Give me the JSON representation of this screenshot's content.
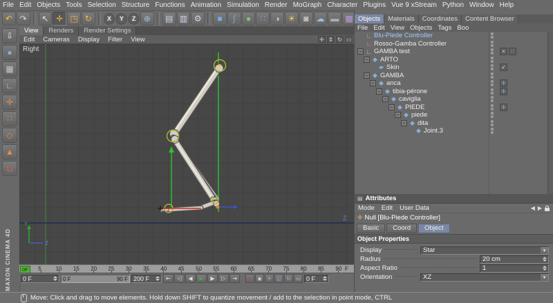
{
  "window": {
    "status_bar": {
      "icon": "mouse-icon",
      "text": "Move: Click and drag to move elements. Hold down SHIFT to quantize movement / add to the selection in point mode, CTRL"
    }
  },
  "menubar": {
    "items": [
      "File",
      "Edit",
      "Objects",
      "Tools",
      "Selection",
      "Structure",
      "Functions",
      "Animation",
      "Simulation",
      "Render",
      "MoGraph",
      "Character",
      "Plugins",
      "Vue 9 xStream",
      "Python",
      "Window",
      "Help"
    ]
  },
  "toolbar": {
    "icons": [
      {
        "name": "undo-icon",
        "glyph": "↶",
        "color": "#f0c040"
      },
      {
        "name": "redo-icon",
        "glyph": "↷",
        "color": "#d8d8d8"
      },
      {
        "sep": true
      },
      {
        "name": "live-selection-icon",
        "glyph": "↖",
        "color": "#e8e8e8"
      },
      {
        "name": "move-tool-icon",
        "glyph": "✛",
        "color": "#f0b840",
        "active": true
      },
      {
        "name": "scale-tool-icon",
        "glyph": "◳",
        "color": "#f0b840"
      },
      {
        "name": "rotate-tool-icon",
        "glyph": "↻",
        "color": "#f0b840"
      },
      {
        "sep": true
      },
      {
        "name": "x-axis-lock-button",
        "glyph": "X",
        "circle": true
      },
      {
        "name": "y-axis-lock-button",
        "glyph": "Y",
        "circle": true
      },
      {
        "name": "z-axis-lock-button",
        "glyph": "Z",
        "circle": true
      },
      {
        "name": "coordinate-system-icon",
        "glyph": "⊕",
        "color": "#9ac0e8"
      },
      {
        "sep": true
      },
      {
        "name": "render-view-icon",
        "glyph": "▤",
        "color": "#cfd8e8"
      },
      {
        "name": "render-picture-viewer-icon",
        "glyph": "▥",
        "color": "#cfd8e8"
      },
      {
        "name": "render-settings-icon",
        "glyph": "⚙",
        "color": "#cfd8e8"
      },
      {
        "sep": true
      },
      {
        "name": "add-cube-icon",
        "glyph": "■",
        "color": "#78a8e0"
      },
      {
        "name": "add-spline-icon",
        "glyph": "∫",
        "color": "#78a8e0"
      },
      {
        "name": "add-hypernurbs-icon",
        "glyph": "●",
        "color": "#7ec86a"
      },
      {
        "name": "add-array-icon",
        "glyph": "∷",
        "color": "#78a8e0"
      },
      {
        "name": "add-boole-icon",
        "glyph": "◑",
        "color": "#c8c8c8"
      },
      {
        "name": "add-light-icon",
        "glyph": "☀",
        "color": "#f0d048"
      },
      {
        "name": "add-camera-icon",
        "glyph": "◙",
        "color": "#c8c8c8"
      },
      {
        "name": "add-sky-icon",
        "glyph": "☁",
        "color": "#9ac0e8"
      },
      {
        "name": "add-floor-icon",
        "glyph": "▬",
        "color": "#b0b0b0"
      },
      {
        "name": "add-background-icon",
        "glyph": "▩",
        "color": "#b89ad8"
      }
    ]
  },
  "left_palette": {
    "brand": "MAXON CINEMA 4D",
    "icons": [
      {
        "name": "make-editable-icon",
        "glyph": "⇩",
        "color": "#e8e8e8"
      },
      {
        "name": "model-mode-icon",
        "glyph": "●",
        "color": "#88b0d8"
      },
      {
        "name": "texture-mode-icon",
        "glyph": "▦",
        "color": "#c8c8c8"
      },
      {
        "name": "workplane-mode-icon",
        "glyph": "∟",
        "color": "#c8c8c8"
      },
      {
        "name": "object-axis-mode-icon",
        "glyph": "✛",
        "color": "#e89040"
      },
      {
        "name": "points-mode-icon",
        "glyph": "∷",
        "color": "#e89040"
      },
      {
        "name": "edges-mode-icon",
        "glyph": "◇",
        "color": "#e89040"
      },
      {
        "name": "polygons-mode-icon",
        "glyph": "▲",
        "color": "#e89040"
      },
      {
        "name": "snap-settings-icon",
        "glyph": "⊔",
        "color": "#e06040"
      }
    ]
  },
  "viewport": {
    "view_label": "Right",
    "tabs": [
      {
        "label": "View",
        "active": true
      },
      {
        "label": "Renders",
        "active": false
      },
      {
        "label": "Render Settings",
        "active": false
      }
    ],
    "menu": [
      "Edit",
      "Cameras",
      "Display",
      "Filter",
      "View"
    ],
    "corner_icons": [
      {
        "name": "pan-view-icon",
        "glyph": "✛"
      },
      {
        "name": "dolly-view-icon",
        "glyph": "⇕"
      },
      {
        "name": "orbit-view-icon",
        "glyph": "↻"
      },
      {
        "name": "toggle-panels-icon",
        "glyph": "▭"
      }
    ],
    "timeline": {
      "current_marker": "0F",
      "tick_labels": [
        "5",
        "10",
        "15",
        "20",
        "25",
        "30",
        "35",
        "40",
        "45",
        "50",
        "55",
        "60",
        "65",
        "70",
        "75",
        "80",
        "85",
        "90"
      ],
      "unit": "F"
    },
    "transport": {
      "current_frame": "0 F",
      "range_start": "0 F",
      "range_end": "90 F",
      "document_max": "200 F",
      "end_frame_field": "0 F",
      "buttons": [
        {
          "name": "goto-start-button",
          "glyph": "⇤"
        },
        {
          "name": "previous-key-button",
          "glyph": "◁"
        },
        {
          "name": "previous-frame-button",
          "glyph": "◀"
        },
        {
          "name": "play-button",
          "glyph": "▶",
          "color": "#3fae3f"
        },
        {
          "name": "next-frame-button",
          "glyph": "▶"
        },
        {
          "name": "next-key-button",
          "glyph": "▷"
        },
        {
          "name": "goto-end-button",
          "glyph": "⇥"
        }
      ],
      "record_buttons": [
        {
          "name": "record-keyframe-button",
          "glyph": "●",
          "color": "#d04040"
        },
        {
          "name": "autokey-button",
          "glyph": "◉",
          "color": "#d8d8d8"
        },
        {
          "name": "record-position-button",
          "glyph": "✛",
          "color": "#88b0d8"
        },
        {
          "name": "record-scale-button",
          "glyph": "◱",
          "color": "#88b0d8"
        },
        {
          "name": "record-rotation-button",
          "glyph": "↻",
          "color": "#88b0d8"
        },
        {
          "name": "record-parameter-button",
          "glyph": "▭",
          "color": "#d8d8d8"
        }
      ]
    }
  },
  "right_panel": {
    "tabs": [
      {
        "label": "Objects",
        "active": true
      },
      {
        "label": "Materials",
        "active": false
      },
      {
        "label": "Coordinates",
        "active": false
      },
      {
        "label": "Content Browser",
        "active": false
      }
    ],
    "object_manager": {
      "menu": [
        "File",
        "Edit",
        "View",
        "Objects",
        "Tags",
        "Boo"
      ],
      "tree": [
        {
          "label": "Blu-Piede Controller",
          "indent": 0,
          "expander": false,
          "label_color": "#9ec8ff",
          "icon": {
            "name": "null-object-icon",
            "glyph": "∟",
            "color": "#8ab8f0"
          },
          "tags": []
        },
        {
          "label": "Rosso-Gamba Controller",
          "indent": 0,
          "expander": false,
          "icon": {
            "name": "null-object-icon",
            "glyph": "∟",
            "color": "#f09080"
          },
          "tags": []
        },
        {
          "label": "GAMBA test",
          "indent": 0,
          "expander": true,
          "icon": {
            "name": "null-object-icon",
            "glyph": "∟",
            "color": "#b8d890"
          },
          "tags": [
            {
              "name": "xpresso-tag-icon",
              "glyph": "×",
              "color": "#dcdcdc"
            },
            {
              "name": "display-tag-icon",
              "glyph": "∷",
              "color": "#f0a030"
            }
          ]
        },
        {
          "label": "ARTO",
          "indent": 1,
          "expander": true,
          "icon": {
            "name": "joint-object-icon",
            "glyph": "◆",
            "color": "#86aede"
          },
          "tags": []
        },
        {
          "label": "Skin",
          "indent": 2,
          "expander": false,
          "icon": {
            "name": "skin-object-icon",
            "glyph": "▰",
            "color": "#86aede"
          },
          "tags": [
            {
              "name": "check-icon",
              "glyph": "✓",
              "color": "#e8e8e8"
            }
          ]
        },
        {
          "label": "GAMBA",
          "indent": 1,
          "expander": true,
          "icon": {
            "name": "joint-object-icon",
            "glyph": "◆",
            "color": "#86aede"
          },
          "tags": []
        },
        {
          "label": "anca",
          "indent": 2,
          "expander": true,
          "icon": {
            "name": "joint-object-icon",
            "glyph": "◆",
            "color": "#86aede"
          },
          "tags": [
            {
              "name": "ik-tag-icon",
              "glyph": "✛",
              "color": "#88b0e0"
            }
          ]
        },
        {
          "label": "tibia-pérone",
          "indent": 3,
          "expander": true,
          "icon": {
            "name": "joint-object-icon",
            "glyph": "◆",
            "color": "#86aede"
          },
          "tags": [
            {
              "name": "ik-tag-icon",
              "glyph": "✛",
              "color": "#88b0e0"
            }
          ]
        },
        {
          "label": "caviglia",
          "indent": 4,
          "expander": true,
          "icon": {
            "name": "joint-object-icon",
            "glyph": "◆",
            "color": "#86aede"
          },
          "tags": []
        },
        {
          "label": "PIEDE",
          "indent": 5,
          "expander": true,
          "icon": {
            "name": "joint-object-icon",
            "glyph": "◆",
            "color": "#86aede"
          },
          "tags": [
            {
              "name": "ik-tag-icon",
              "glyph": "✛",
              "color": "#88b0e0"
            }
          ]
        },
        {
          "label": "piede",
          "indent": 6,
          "expander": true,
          "icon": {
            "name": "joint-object-icon",
            "glyph": "◆",
            "color": "#86aede"
          },
          "tags": []
        },
        {
          "label": "dita",
          "indent": 7,
          "expander": true,
          "icon": {
            "name": "joint-object-icon",
            "glyph": "◆",
            "color": "#86aede"
          },
          "tags": []
        },
        {
          "label": "Joint.3",
          "indent": 8,
          "expander": false,
          "icon": {
            "name": "joint-object-icon",
            "glyph": "◆",
            "color": "#86aede"
          },
          "tags": []
        }
      ]
    },
    "attributes": {
      "header": "Attributes",
      "menu": [
        "Mode",
        "Edit",
        "User Data"
      ],
      "title": {
        "icon": "null-axes-icon",
        "label": "Null [Blu-Piede Controller]"
      },
      "tabs": [
        {
          "label": "Basic",
          "active": false
        },
        {
          "label": "Coord",
          "active": false
        },
        {
          "label": "Object",
          "active": true
        }
      ],
      "section": "Object Properties",
      "rows": [
        {
          "label": "Display",
          "value": "Star",
          "type": "dropdown"
        },
        {
          "label": "Radius",
          "value": "20 cm",
          "type": "number"
        },
        {
          "label": "Aspect Ratio",
          "value": "1",
          "type": "number"
        },
        {
          "label": "Orientation",
          "value": "XZ",
          "type": "dropdown"
        }
      ]
    }
  },
  "colors": {
    "panel_bg": "#6b6b6b",
    "viewport_bg": "#474747",
    "active_tab_accent": "#7b87a3",
    "ik_line_green": "#2fbe2f",
    "world_z_axis": "#2c3252",
    "timeline_marker_green": "#55b23a",
    "bone_fill": "#d0ccc4",
    "joint_ring": "#aab430"
  }
}
